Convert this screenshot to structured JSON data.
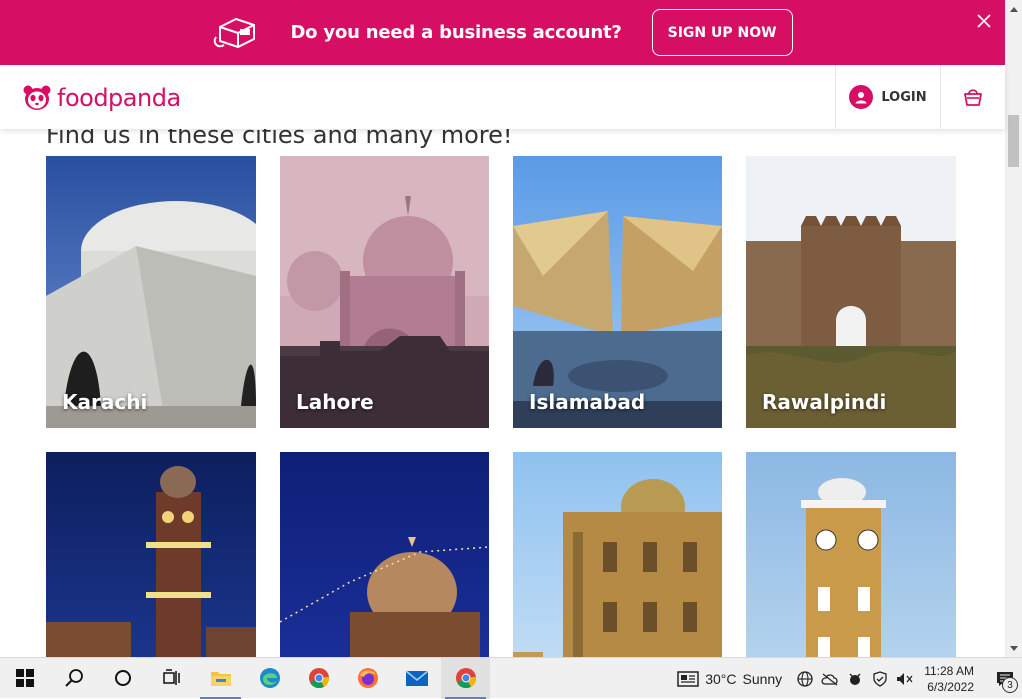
{
  "banner": {
    "text": "Do you need a business account?",
    "signup_label": "SIGN UP NOW",
    "color": "#d70f64"
  },
  "header": {
    "brand": "foodpanda",
    "login_label": "LOGIN",
    "brand_color": "#d70f64"
  },
  "main": {
    "section_title": "Find us in these cities and many more!",
    "cities": [
      {
        "name": "Karachi"
      },
      {
        "name": "Lahore"
      },
      {
        "name": "Islamabad"
      },
      {
        "name": "Rawalpindi"
      },
      {
        "name": ""
      },
      {
        "name": ""
      },
      {
        "name": ""
      },
      {
        "name": ""
      }
    ]
  },
  "taskbar": {
    "apps": [
      "start",
      "search",
      "cortana",
      "task-view",
      "file-explorer",
      "edge",
      "chrome",
      "firefox",
      "mail",
      "chrome-active"
    ],
    "weather_temp": "30°C",
    "weather_text": "Sunny",
    "time": "11:28 AM",
    "date": "6/3/2022",
    "notification_count": "3"
  }
}
